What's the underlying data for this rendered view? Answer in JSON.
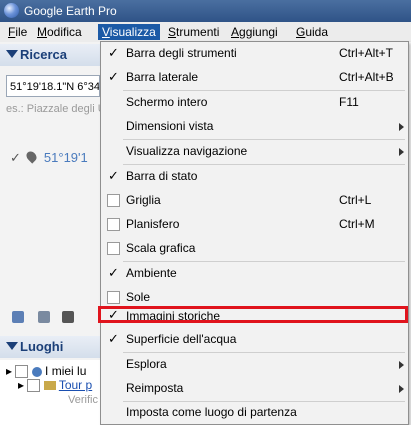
{
  "window": {
    "title": "Google Earth Pro",
    "app_icon": "globe-icon"
  },
  "menubar": [
    {
      "label": "File",
      "u": "F",
      "rest": "ile"
    },
    {
      "label": "Modifica",
      "u": "M",
      "rest": "odifica"
    },
    {
      "label": "Visualizza",
      "u": "V",
      "rest": "isualizza",
      "active": true
    },
    {
      "label": "Strumenti",
      "u": "S",
      "rest": "trumenti"
    },
    {
      "label": "Aggiungi",
      "u": "A",
      "rest": "ggiungi"
    },
    {
      "label": "Guida",
      "u": "G",
      "rest": "uida"
    }
  ],
  "search": {
    "header": "Ricerca",
    "value": "51°19'18.1\"N 6°34",
    "placeholder": "es.: Piazzale degli U",
    "result": "51°19'1"
  },
  "places": {
    "header": "Luoghi",
    "items": [
      "I miei lu",
      "Tour p",
      "Verific"
    ]
  },
  "menu": {
    "items": [
      {
        "label": "Barra degli strumenti",
        "shortcut": "Ctrl+Alt+T",
        "check": "on"
      },
      {
        "label": "Barra laterale",
        "shortcut": "Ctrl+Alt+B",
        "check": "on"
      },
      {
        "label": "Schermo intero",
        "shortcut": "F11"
      },
      {
        "label": "Dimensioni vista",
        "submenu": true
      },
      {
        "label": "Visualizza navigazione",
        "submenu": true
      },
      {
        "label": "Barra di stato",
        "check": "on"
      },
      {
        "label": "Griglia",
        "shortcut": "Ctrl+L",
        "check": "off"
      },
      {
        "label": "Planisfero",
        "shortcut": "Ctrl+M",
        "check": "off"
      },
      {
        "label": "Scala grafica",
        "check": "off"
      },
      {
        "label": "Ambiente",
        "check": "on"
      },
      {
        "label": "Sole",
        "check": "off"
      },
      {
        "label": "Immagini storiche",
        "check": "on",
        "highlighted": true
      },
      {
        "label": "Superficie dell'acqua",
        "check": "on"
      },
      {
        "label": "Esplora",
        "submenu": true
      },
      {
        "label": "Reimposta",
        "submenu": true
      },
      {
        "label": "Imposta come luogo di partenza"
      }
    ]
  },
  "colors": {
    "highlight_border": "#e0141d",
    "menu_active": "#1c5aa6"
  }
}
